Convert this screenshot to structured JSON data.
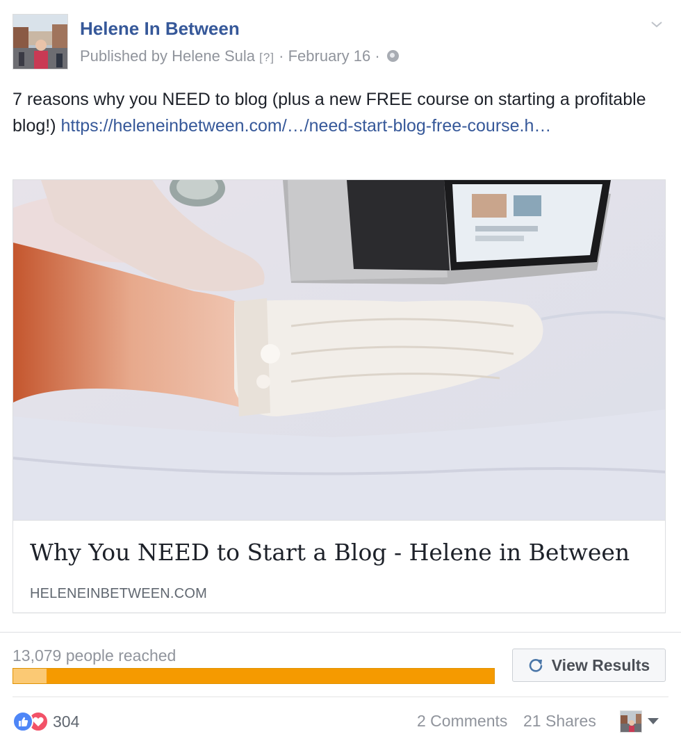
{
  "header": {
    "page_name": "Helene In Between",
    "published_prefix": "Published by",
    "author": "Helene Sula",
    "help_marker": "[?]",
    "date": "February 16",
    "separator": "·"
  },
  "post": {
    "text": "7 reasons why you NEED to blog (plus a new FREE course on starting a profitable blog!) ",
    "link_text": "https://heleneinbetween.com/…/need-start-blog-free-course.h…"
  },
  "link_card": {
    "title": "Why You NEED to Start a Blog - Helene in Between",
    "domain": "HELENEINBETWEEN.COM"
  },
  "insights": {
    "reach_text": "13,079 people reached",
    "organic_fraction": 0.07,
    "view_results_label": "View Results"
  },
  "footer": {
    "reaction_count": "304",
    "comments": "2 Comments",
    "shares": "21 Shares"
  },
  "colors": {
    "link_blue": "#365899",
    "progress_paid": "#f59a00",
    "progress_organic": "#fbc974",
    "like_blue": "#4e86f7",
    "love_red": "#f25268"
  },
  "icons": [
    "globe-icon",
    "chevron-down-icon",
    "refresh-icon",
    "like-icon",
    "love-icon",
    "caret-down-icon"
  ]
}
